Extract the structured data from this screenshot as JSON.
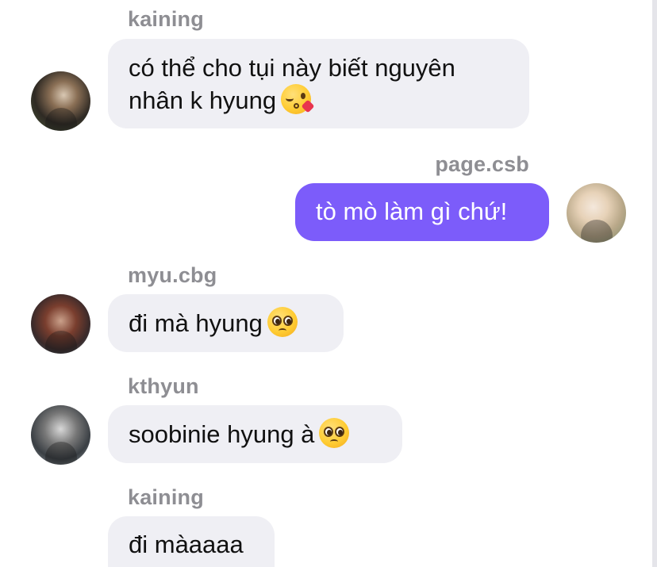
{
  "messages": [
    {
      "sender": "kaining",
      "line1": "có thể cho tụi này biết nguyên",
      "line2": "nhân k hyung",
      "emoji": "kissing-heart-emoji",
      "direction": "incoming"
    },
    {
      "sender": "page.csb",
      "text": "tò mò làm gì chứ!",
      "direction": "outgoing"
    },
    {
      "sender": "myu.cbg",
      "text": "đi mà hyung",
      "emoji": "pleading-face-emoji",
      "direction": "incoming"
    },
    {
      "sender": "kthyun",
      "text": "soobinie hyung à",
      "emoji": "pleading-face-emoji",
      "direction": "incoming"
    },
    {
      "sender": "kaining",
      "text": "đi màaaaa",
      "direction": "incoming"
    }
  ],
  "colors": {
    "incoming_bubble": "#efeff4",
    "outgoing_bubble": "#7c5cfa",
    "sender_name": "#8e8e93"
  }
}
